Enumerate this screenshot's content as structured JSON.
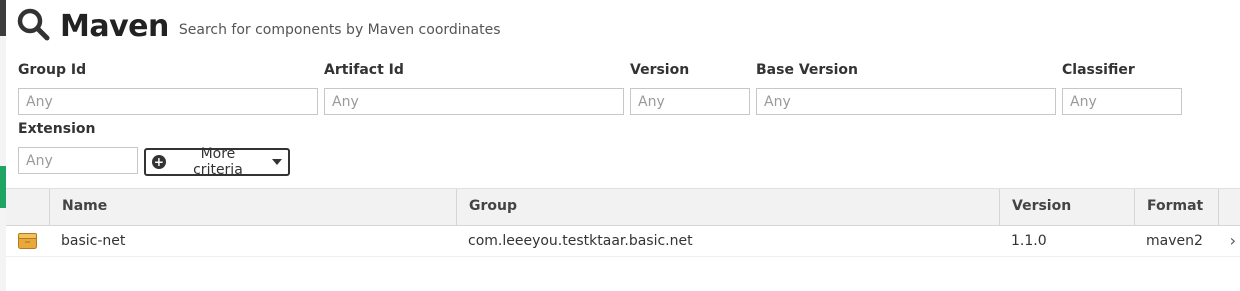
{
  "header": {
    "icon": "search-icon",
    "title": "Maven",
    "subtitle": "Search for components by Maven coordinates"
  },
  "criteria": {
    "group_id": {
      "label": "Group Id",
      "placeholder": "Any"
    },
    "artifact_id": {
      "label": "Artifact Id",
      "placeholder": "Any"
    },
    "version": {
      "label": "Version",
      "placeholder": "Any"
    },
    "base_version": {
      "label": "Base Version",
      "placeholder": "Any"
    },
    "classifier": {
      "label": "Classifier",
      "placeholder": "Any"
    },
    "extension": {
      "label": "Extension",
      "placeholder": "Any"
    },
    "more_criteria": "More criteria"
  },
  "table": {
    "columns": [
      "Name",
      "Group",
      "Version",
      "Format"
    ],
    "rows": [
      {
        "icon": "package-icon",
        "name": "basic-net",
        "group": "com.leeeyou.testktaar.basic.net",
        "version": "1.1.0",
        "format": "maven2"
      }
    ]
  },
  "colors": {
    "accent_green": "#1fa463",
    "package_icon": "#e8a93a"
  }
}
